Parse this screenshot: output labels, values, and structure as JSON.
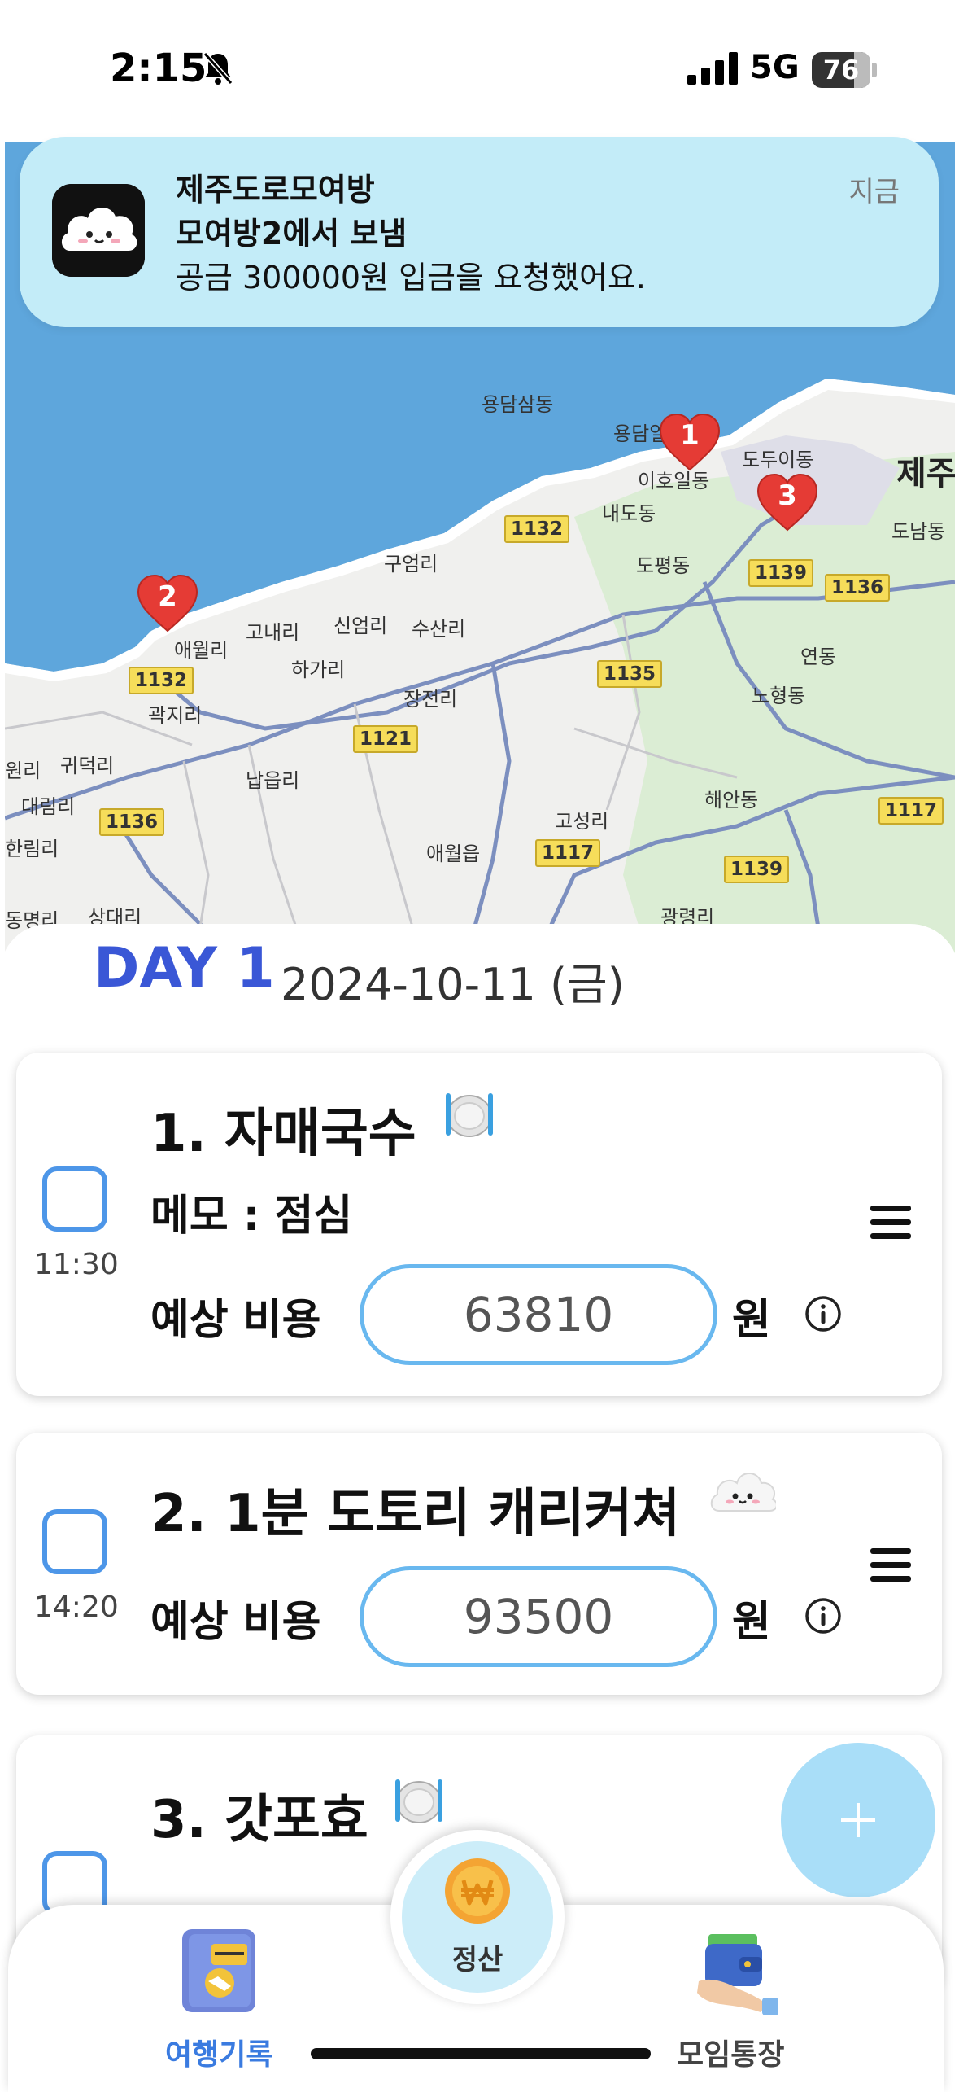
{
  "status_bar": {
    "time": "2:15",
    "network": "5G",
    "battery": "76"
  },
  "notification": {
    "title": "제주도로모여방",
    "subtitle": "모여방2에서 보냄",
    "body": "공금 300000원 입금을 요청했어요.",
    "time": "지금"
  },
  "map": {
    "labels": {
      "yongdam_samdong": "용담삼동",
      "yongdam_ildong": "용담일동",
      "dodu_idong": "도두이동",
      "ihoildong": "이호일동",
      "jeju": "제주",
      "naedo": "내도동",
      "donam": "도남동",
      "dopyeong": "도평동",
      "gueomri": "구엄리",
      "gonaeri": "고내리",
      "sineomri": "신엄리",
      "susanri": "수산리",
      "aewolri": "애월리",
      "hagari": "하가리",
      "jangjeonri": "장전리",
      "yeondong": "연동",
      "nohyeong": "노형동",
      "gwakjiri": "곽지리",
      "gwideokri": "귀덕리",
      "wonri": "원리",
      "daerimri": "대림리",
      "ganlimri": "한림리",
      "nabeupri": "납읍리",
      "goseongri": "고성리",
      "haeandong": "해안동",
      "aewoleup": "애월읍",
      "dongmyeongri": "동명리",
      "sangdaeri": "상대리",
      "gwangryeongri": "광령리"
    },
    "roads": {
      "r1132a": "1132",
      "r1139a": "1139",
      "r1136a": "1136",
      "r1132b": "1132",
      "r1135": "1135",
      "r1121": "1121",
      "r1136b": "1136",
      "r1117a": "1117",
      "r1117b": "1117",
      "r1139b": "1139"
    },
    "pins": [
      "1",
      "2",
      "3"
    ]
  },
  "day": {
    "label": "DAY 1",
    "date": "2024-10-11 (금)"
  },
  "schedule": [
    {
      "title": "1. 자매국수",
      "category_icon": "dining-icon",
      "memo": "메모 :  점심",
      "time": "11:30",
      "cost_label": "예상 비용",
      "cost": "63810",
      "unit": "원",
      "checked": false
    },
    {
      "title": "2. 1분 도토리 캐리커쳐",
      "category_icon": "cloud-mascot-icon",
      "time": "14:20",
      "cost_label": "예상 비용",
      "cost": "93500",
      "unit": "원",
      "checked": false
    },
    {
      "title": "3. 갓포효",
      "category_icon": "dining-icon",
      "checked": false
    }
  ],
  "tabbar": {
    "travel_log": "여행기록",
    "settle": "정산",
    "group_account": "모임통장"
  },
  "colors": {
    "accent_blue": "#3a57d6",
    "checkbox_blue": "#4d96e8",
    "fab": "#a9def8",
    "notification_bg": "#c3ecf8",
    "active_tab": "#3a7be0"
  }
}
